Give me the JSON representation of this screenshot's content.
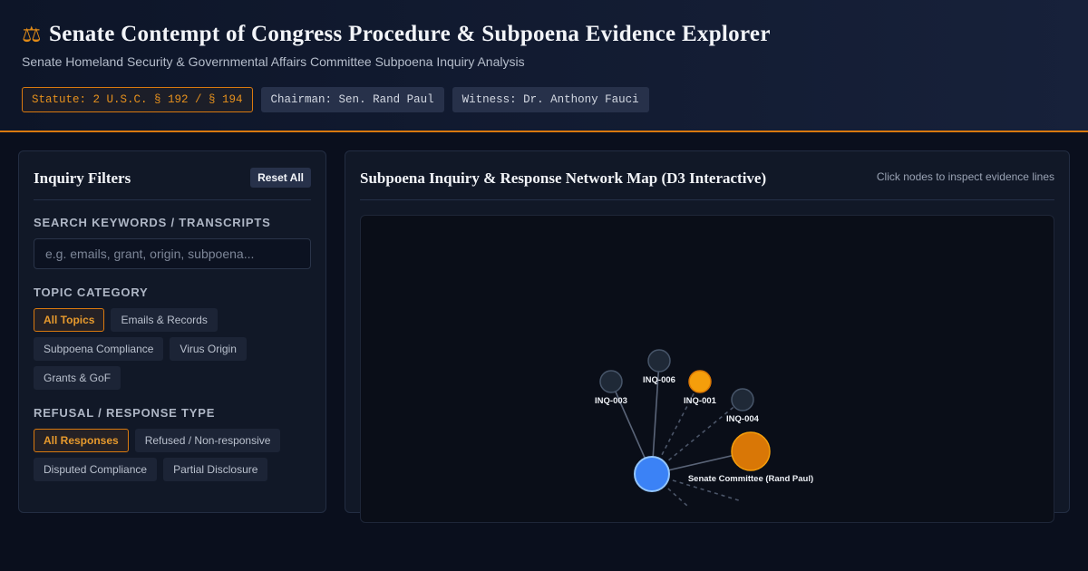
{
  "header": {
    "icon": "balance-scale-icon",
    "title": "Senate Contempt of Congress Procedure & Subpoena Evidence Explorer",
    "subtitle": "Senate Homeland Security & Governmental Affairs Committee Subpoena Inquiry Analysis",
    "tags": {
      "statute": "Statute: 2 U.S.C. § 192 / § 194",
      "chairman": "Chairman: Sen. Rand Paul",
      "witness": "Witness: Dr. Anthony Fauci"
    }
  },
  "filters": {
    "title": "Inquiry Filters",
    "reset_label": "Reset All",
    "search_label": "SEARCH KEYWORDS / TRANSCRIPTS",
    "search_placeholder": "e.g. emails, grant, origin, subpoena...",
    "search_value": "",
    "topic_label": "TOPIC CATEGORY",
    "topics": [
      "All Topics",
      "Emails & Records",
      "Subpoena Compliance",
      "Virus Origin",
      "Grants & GoF"
    ],
    "active_topic": "All Topics",
    "response_label": "REFUSAL / RESPONSE TYPE",
    "responses": [
      "All Responses",
      "Refused / Non-responsive",
      "Disputed Compliance",
      "Partial Disclosure"
    ],
    "active_response": "All Responses"
  },
  "network": {
    "title": "Subpoena Inquiry & Response Network Map (D3 Interactive)",
    "hint": "Click nodes to inspect evidence lines",
    "colors": {
      "hub": "#3b82f6",
      "committee": "#d97706",
      "selected": "#f59e0b",
      "inquiry": "#1f2937"
    },
    "nodes": [
      {
        "id": "hub",
        "label": "",
        "kind": "hub"
      },
      {
        "id": "committee",
        "label": "Senate Committee (Rand Paul)",
        "kind": "committee"
      },
      {
        "id": "INQ-003",
        "label": "INQ-003",
        "kind": "inquiry"
      },
      {
        "id": "INQ-006",
        "label": "INQ-006",
        "kind": "inquiry"
      },
      {
        "id": "INQ-001",
        "label": "INQ-001",
        "kind": "selected"
      },
      {
        "id": "INQ-004",
        "label": "INQ-004",
        "kind": "inquiry"
      }
    ],
    "links": [
      {
        "source": "hub",
        "target": "INQ-003",
        "style": "solid"
      },
      {
        "source": "hub",
        "target": "INQ-006",
        "style": "solid"
      },
      {
        "source": "hub",
        "target": "INQ-001",
        "style": "dashed"
      },
      {
        "source": "hub",
        "target": "INQ-004",
        "style": "dashed"
      },
      {
        "source": "hub",
        "target": "committee",
        "style": "solid"
      },
      {
        "source": "hub",
        "target": "offscreen-a",
        "style": "dashed"
      },
      {
        "source": "hub",
        "target": "offscreen-b",
        "style": "dashed"
      }
    ]
  }
}
